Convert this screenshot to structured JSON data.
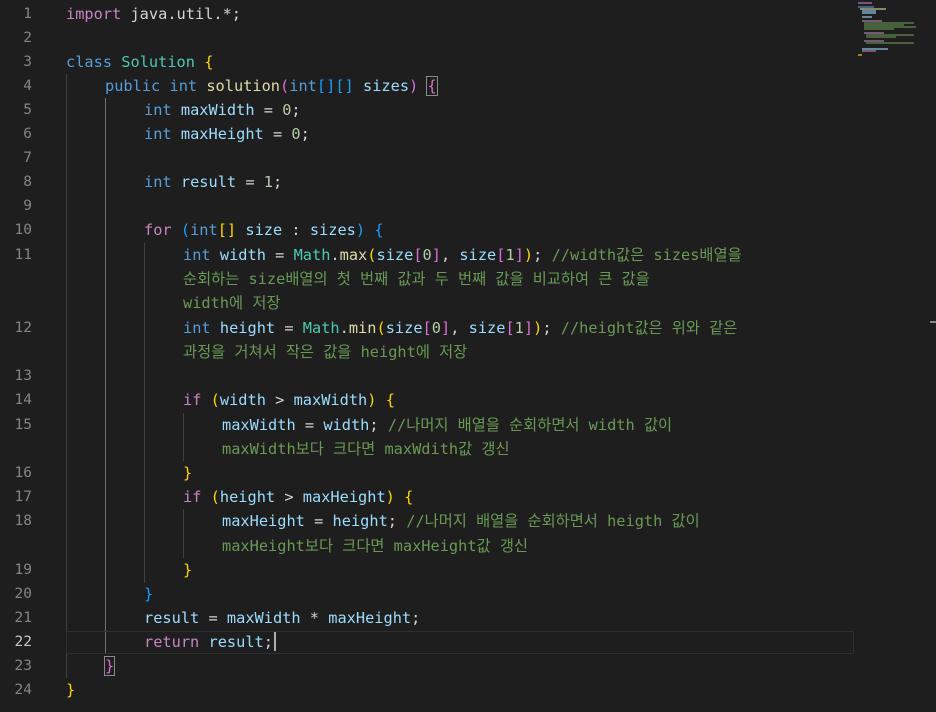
{
  "editor": {
    "active_line": "22",
    "line_numbers": [
      "1",
      "2",
      "3",
      "4",
      "5",
      "6",
      "7",
      "8",
      "9",
      "10",
      "11",
      "12",
      "13",
      "14",
      "15",
      "16",
      "17",
      "18",
      "19",
      "20",
      "21",
      "22",
      "23",
      "24"
    ],
    "code": {
      "l1": {
        "kw": "import",
        "rest": " java.util.*;"
      },
      "l3": {
        "kw": "class",
        "cls": "Solution",
        "brace": "{"
      },
      "l4": {
        "kw1": "public",
        "kw2": "int",
        "fn": "solution",
        "paren_open": "(",
        "type": "int",
        "b_open1": "[",
        "b_close1": "]",
        "b_open2": "[",
        "b_close2": "]",
        "param": "sizes",
        "paren_close": ")",
        "brace": "{"
      },
      "l5": {
        "type": "int",
        "var": "maxWidth",
        "eq": " = ",
        "num": "0",
        "semi": ";"
      },
      "l6": {
        "type": "int",
        "var": "maxHeight",
        "eq": " = ",
        "num": "0",
        "semi": ";"
      },
      "l8": {
        "type": "int",
        "var": "result",
        "eq": " = ",
        "num": "1",
        "semi": ";"
      },
      "l10": {
        "kw": "for",
        "paren_open": "(",
        "type": "int",
        "brackets": "[]",
        "var": "size",
        "colon": " : ",
        "iter": "sizes",
        "paren_close": ")",
        "brace": "{"
      },
      "l11": {
        "type": "int",
        "var": "width",
        "eq": " = ",
        "cls": "Math",
        "dot": ".",
        "fn": "max",
        "p_open": "(",
        "arg1": "size",
        "ix1_open": "[",
        "ix1": "0",
        "ix1_close": "]",
        "comma": ", ",
        "arg2": "size",
        "ix2_open": "[",
        "ix2": "1",
        "ix2_close": "]",
        "p_close": ")",
        "semi": ";",
        "comment_1": "//width값은 sizes배열을",
        "comment_2": "순회하는 size배열의 첫 번째 값과 두 번째 값을 비교하여 큰 값을",
        "comment_3": "width에 저장"
      },
      "l12": {
        "type": "int",
        "var": "height",
        "eq": " = ",
        "cls": "Math",
        "dot": ".",
        "fn": "min",
        "p_open": "(",
        "arg1": "size",
        "ix1_open": "[",
        "ix1": "0",
        "ix1_close": "]",
        "comma": ", ",
        "arg2": "size",
        "ix2_open": "[",
        "ix2": "1",
        "ix2_close": "]",
        "p_close": ")",
        "semi": ";",
        "comment_1": "//height값은 위와 같은",
        "comment_2": "과정을 거쳐서 작은 값을 height에 저장"
      },
      "l14": {
        "kw": "if",
        "p_open": "(",
        "a": "width",
        "op": " > ",
        "b": "maxWidth",
        "p_close": ")",
        "brace": "{"
      },
      "l15": {
        "a": "maxWidth",
        "eq": " = ",
        "b": "width",
        "semi": ";",
        "comment_1": "//나머지 배열을 순회하면서 width 값이",
        "comment_2": "maxWidth보다 크다면 maxWdith값 갱신"
      },
      "l16": {
        "brace": "}"
      },
      "l17": {
        "kw": "if",
        "p_open": "(",
        "a": "height",
        "op": " > ",
        "b": "maxHeight",
        "p_close": ")",
        "brace": "{"
      },
      "l18": {
        "a": "maxHeight",
        "eq": " = ",
        "b": "height",
        "semi": ";",
        "comment_1": "//나머지 배열을 순회하면서 heigth 값이",
        "comment_2": "maxHeight보다 크다면 maxHeight값 갱신"
      },
      "l19": {
        "brace": "}"
      },
      "l20": {
        "brace": "}"
      },
      "l21": {
        "a": "result",
        "eq": " = ",
        "b": "maxWidth",
        "op": " * ",
        "c": "maxHeight",
        "semi": ";"
      },
      "l22": {
        "kw": "return",
        "var": "result",
        "semi": ";"
      },
      "l23": {
        "brace": "}"
      },
      "l24": {
        "brace": "}"
      }
    }
  },
  "colors": {
    "background": "#1e1e1e",
    "keyword": "#569cd6",
    "control": "#c586c0",
    "class": "#4ec9b0",
    "function": "#dcdcaa",
    "variable": "#9cdcfe",
    "number": "#b5cea8",
    "comment": "#6a9955",
    "bracket_level1": "#ffd700",
    "bracket_level2": "#da70d6",
    "bracket_level3": "#179fff"
  }
}
